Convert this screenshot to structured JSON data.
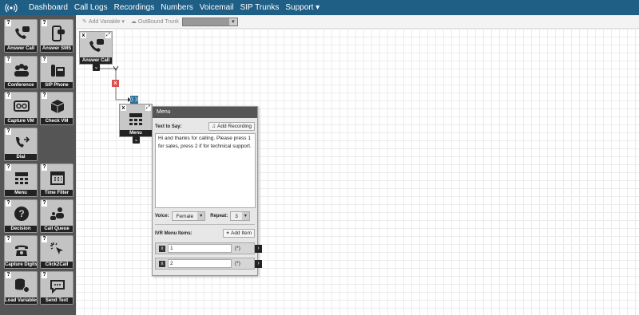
{
  "nav": {
    "items": [
      "Dashboard",
      "Call Logs",
      "Recordings",
      "Numbers",
      "Voicemail",
      "SIP Trunks",
      "Support ▾"
    ]
  },
  "toolbar": {
    "add_variable": "Add Variable ▾",
    "outbound_trunk": "OutBound Trunk"
  },
  "tools": [
    "Answer Call",
    "Answer SMS",
    "Conference",
    "SIP Phone",
    "Capture VM",
    "Check VM",
    "Dial",
    "Menu",
    "Time Filter",
    "Decision",
    "Call Queue",
    "Capture Digits",
    "Click2Call",
    "Load Variables",
    "Send Text"
  ],
  "canvas": {
    "answer_node_label": "Answer Call",
    "menu_node_label": "Menu"
  },
  "panel": {
    "title": "Menu",
    "text_to_say_label": "Text to Say:",
    "add_recording": "Add Recording",
    "text_value": "Hi and thanks for calling. Please press 1 for sales, press 2 if for technical support.",
    "voice_label": "Voice:",
    "voice_value": "Female",
    "repeat_label": "Repeat:",
    "repeat_value": "3",
    "ivr_label": "IVR Menu Items:",
    "add_item": "Add Item",
    "items": [
      {
        "value": "1",
        "suffix": "(*)"
      },
      {
        "value": "2",
        "suffix": "(*)"
      }
    ]
  }
}
